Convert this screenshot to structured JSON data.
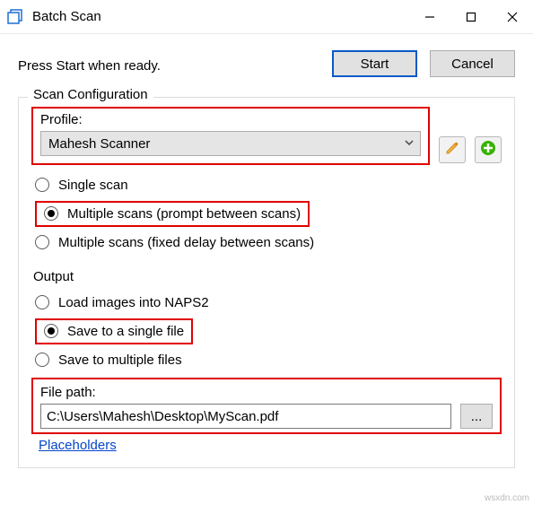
{
  "window": {
    "title": "Batch Scan",
    "min_label": "Minimize",
    "max_label": "Maximize",
    "close_label": "Close"
  },
  "top": {
    "message": "Press Start when ready.",
    "start": "Start",
    "cancel": "Cancel"
  },
  "scan": {
    "legend": "Scan Configuration",
    "profile_label": "Profile:",
    "profile_value": "Mahesh Scanner",
    "radio1": "Single scan",
    "radio2": "Multiple scans (prompt between scans)",
    "radio3": "Multiple scans (fixed delay between scans)",
    "selected_index": 1
  },
  "output": {
    "legend": "Output",
    "radio1": "Load images into NAPS2",
    "radio2": "Save to a single file",
    "radio3": "Save to multiple files",
    "selected_index": 1,
    "filepath_label": "File path:",
    "filepath_value": "C:\\Users\\Mahesh\\Desktop\\MyScan.pdf",
    "browse_ellipsis": "...",
    "placeholders_link": "Placeholders"
  },
  "icons": {
    "app": "app-icon",
    "edit": "pencil-icon",
    "add": "plus-icon"
  },
  "colors": {
    "highlight": "#e00000",
    "primary_border": "#0a58c8",
    "link": "#0645c8",
    "add_green": "#36b400",
    "pencil": "#d88700"
  },
  "watermark": "wsxdn.com"
}
